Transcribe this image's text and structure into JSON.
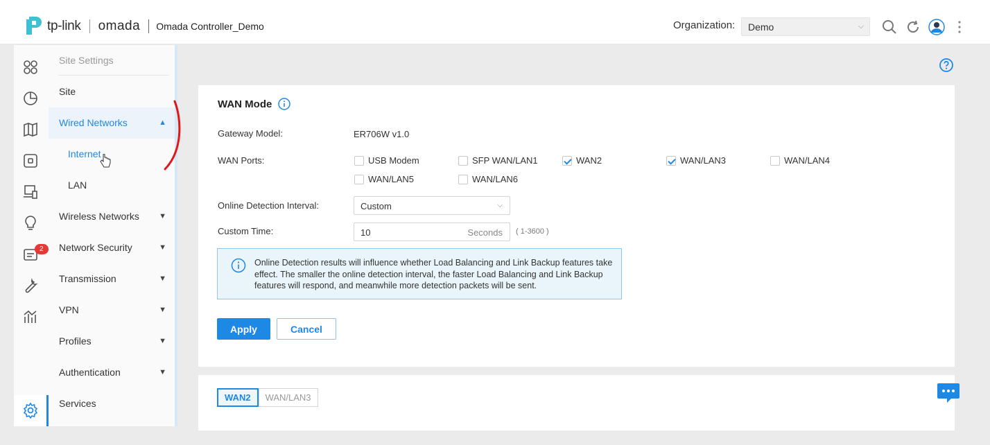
{
  "header": {
    "brand": "tp-link",
    "product": "omada",
    "site_title": "Omada Controller_Demo",
    "org_label": "Organization:",
    "org_value": "Demo"
  },
  "rail": {
    "icons": [
      "dashboard-icon",
      "statistics-icon",
      "map-icon",
      "devices-icon",
      "clients-icon",
      "insight-icon",
      "logs-icon",
      "tools-icon",
      "reports-icon",
      "settings-icon"
    ],
    "logs_badge": "2"
  },
  "menu": {
    "header": "Site Settings",
    "items": {
      "site": "Site",
      "wired": "Wired Networks",
      "internet": "Internet",
      "lan": "LAN",
      "wireless": "Wireless Networks",
      "security": "Network Security",
      "transmission": "Transmission",
      "vpn": "VPN",
      "profiles": "Profiles",
      "authentication": "Authentication",
      "services": "Services"
    }
  },
  "wan_mode": {
    "title": "WAN Mode",
    "gateway_label": "Gateway Model:",
    "gateway_value": "ER706W v1.0",
    "ports_label": "WAN Ports:",
    "ports": [
      {
        "label": "USB Modem",
        "checked": false
      },
      {
        "label": "SFP WAN/LAN1",
        "checked": false
      },
      {
        "label": "WAN2",
        "checked": true
      },
      {
        "label": "WAN/LAN3",
        "checked": true
      },
      {
        "label": "WAN/LAN4",
        "checked": false
      },
      {
        "label": "WAN/LAN5",
        "checked": false
      },
      {
        "label": "WAN/LAN6",
        "checked": false
      }
    ],
    "interval_label": "Online Detection Interval:",
    "interval_value": "Custom",
    "custom_time_label": "Custom Time:",
    "custom_time_value": "10",
    "custom_time_unit": "Seconds",
    "custom_time_range": "( 1-3600 )",
    "notice": "Online Detection results will influence whether Load Balancing and Link Backup features take effect. The smaller the online detection interval, the faster Load Balancing and Link Backup features will respond, and meanwhile more detection packets will be sent.",
    "apply_label": "Apply",
    "cancel_label": "Cancel"
  },
  "wan_tabs": [
    "WAN2",
    "WAN/LAN3"
  ],
  "colors": {
    "accent": "#1e88e5",
    "badge": "#e53935",
    "annotation": "#e0161b"
  }
}
